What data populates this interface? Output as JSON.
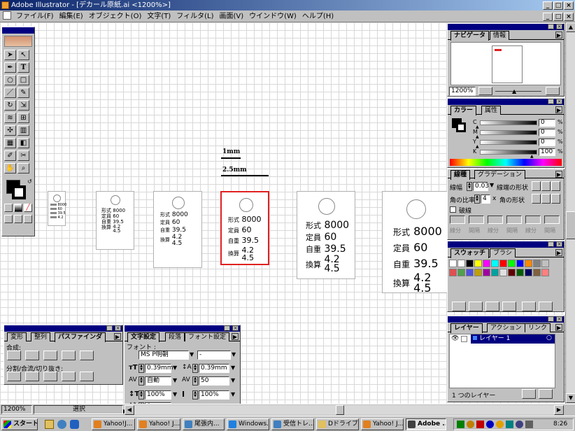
{
  "window": {
    "title": "Adobe Illustrator - [デカール原紙.ai <1200%>]",
    "controls": {
      "min": "_",
      "max": "□",
      "close": "×"
    }
  },
  "menu": [
    "ファイル(F)",
    "編集(E)",
    "オブジェクト(O)",
    "文字(T)",
    "フィルタ(L)",
    "画面(V)",
    "ウインドウ(W)",
    "ヘルプ(H)"
  ],
  "rulers": {
    "r1": "1mm",
    "r2": "2.5mm"
  },
  "decal": {
    "labels": [
      "形式",
      "定員",
      "自重",
      "換算"
    ],
    "values": [
      "8000",
      "60",
      "39.5",
      "4.2",
      "4.5"
    ]
  },
  "navigator": {
    "tabs": [
      "ナビゲータ",
      "情報"
    ],
    "zoom": "1200%"
  },
  "color_panel": {
    "tabs": [
      "カラー",
      "属性"
    ],
    "channels": [
      {
        "name": "C",
        "value": "0"
      },
      {
        "name": "M",
        "value": "0"
      },
      {
        "name": "Y",
        "value": "0"
      },
      {
        "name": "K",
        "value": "100"
      }
    ],
    "unit": "%"
  },
  "stroke_panel": {
    "tabs": [
      "線種",
      "グラデーション"
    ],
    "weight_label": "線幅",
    "weight_value": "0.03",
    "cap_label": "線端の形状",
    "miter_label": "角の比率",
    "miter_value": "4",
    "join_label": "角の形状",
    "dash_label": "破線",
    "dash_cols": [
      "線分",
      "間隔",
      "線分",
      "間隔",
      "線分",
      "間隔"
    ]
  },
  "swatches_panel": {
    "tabs": [
      "スウォッチ",
      "ブラシ"
    ]
  },
  "layers_panel": {
    "tabs": [
      "レイヤー",
      "アクション",
      "リンク"
    ],
    "layer_name": "レイヤー 1",
    "count": "1 つのレイヤー"
  },
  "pathfinder_panel": {
    "tabs": [
      "変形",
      "整列",
      "パスファインダ"
    ],
    "section1": "合成:",
    "section2": "分割/合流/切り抜き:"
  },
  "char_panel": {
    "tabs": [
      "文字設定",
      "段落",
      "フォント設定"
    ],
    "font_label": "フォント :",
    "font_name": "MS P明朝",
    "font_style": "-",
    "size": "0.39mm",
    "leading": "0.39mm",
    "kerning": "自動",
    "tracking": "50",
    "vscale": "100%",
    "hscale": "100%",
    "baseline": "0mm"
  },
  "status": {
    "zoom": "1200%",
    "tool": "選択"
  },
  "taskbar": {
    "start": "スタート",
    "items": [
      "Yahoo!J...",
      "Yahoo! J...",
      "尾張内...",
      "Windows...",
      "受信トレ...",
      "Dドライブ...",
      "Yahoo! J...",
      "Adobe ..."
    ],
    "time": "8:26"
  },
  "colors": {
    "title_start": "#0a246a",
    "title_end": "#a6caf0",
    "panel_bg": "#c0c0c0",
    "selection": "#e02020",
    "layer_highlight": "#000080"
  }
}
